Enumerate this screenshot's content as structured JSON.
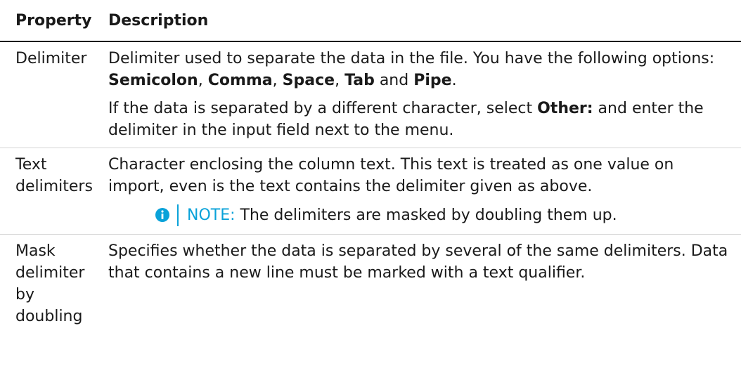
{
  "header": {
    "property": "Property",
    "description": "Description"
  },
  "rows": [
    {
      "property": "Delimiter",
      "p1_prefix": "Delimiter used to separate the data in the file. You have the following options: ",
      "options": [
        "Semicolon",
        "Comma",
        "Space",
        "Tab",
        "Pipe"
      ],
      "sep_comma": ", ",
      "sep_and": " and ",
      "end_period": ".",
      "p2_prefix": "If the data is separated by a different character, select ",
      "p2_bold": "Other:",
      "p2_suffix": " and enter the delimiter in the input field next to the menu."
    },
    {
      "property": "Text delimiters",
      "p1": "Character enclosing the column text. This text is treated as one value on import, even is the text contains the delimiter given as above.",
      "note_label": "NOTE:",
      "note_text": " The delimiters are masked by doubling them up."
    },
    {
      "property": "Mask delimiter by doubling",
      "p1": "Specifies whether the data is separated by several of the same delimiters. Data that contains a new line must be marked with a text qualifier."
    }
  ],
  "colors": {
    "note_accent": "#0aa2d9",
    "text": "#1a1a1a",
    "rule": "#d4d4d4"
  },
  "icons": {
    "note": "info-icon"
  }
}
